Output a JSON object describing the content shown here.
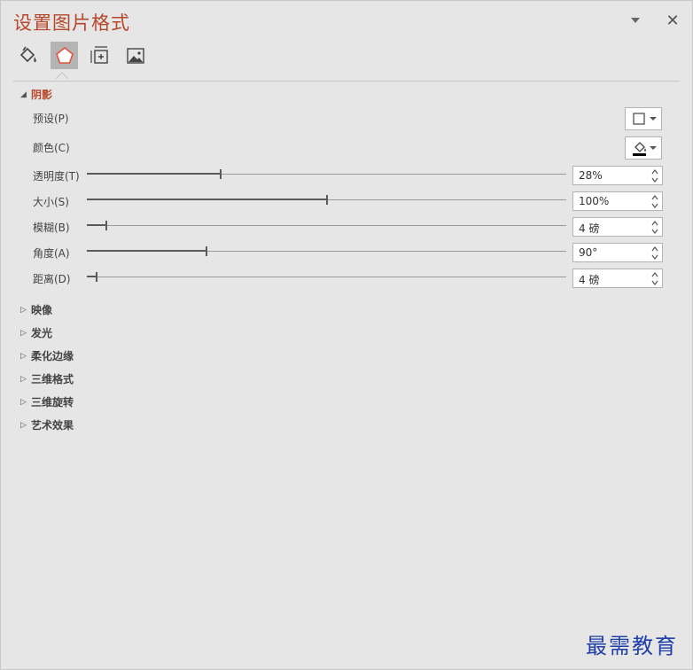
{
  "panel": {
    "title": "设置图片格式",
    "collapse_icon": "chevron-down-icon",
    "close_icon": "close-icon",
    "close_glyph": "✕"
  },
  "tabs": [
    {
      "name": "fill-line",
      "icon": "paint-bucket-icon",
      "active": false
    },
    {
      "name": "effects",
      "icon": "pentagon-icon",
      "active": true
    },
    {
      "name": "size-properties",
      "icon": "size-properties-icon",
      "active": false
    },
    {
      "name": "picture",
      "icon": "picture-icon",
      "active": false
    }
  ],
  "shadow": {
    "header": "阴影",
    "expanded_glyph": "◢",
    "preset_label": "预设(P)",
    "color_label": "颜色(C)",
    "sliders": [
      {
        "label": "透明度(T)",
        "value": "28%",
        "level": 0.28
      },
      {
        "label": "大小(S)",
        "value": "100%",
        "level": 0.5
      },
      {
        "label": "模糊(B)",
        "value": "4 磅",
        "level": 0.04
      },
      {
        "label": "角度(A)",
        "value": "90°",
        "level": 0.25
      },
      {
        "label": "距离(D)",
        "value": "4 磅",
        "level": 0.02
      }
    ]
  },
  "collapsed_glyph": "▷",
  "sections": [
    {
      "label": "映像"
    },
    {
      "label": "发光"
    },
    {
      "label": "柔化边缘"
    },
    {
      "label": "三维格式"
    },
    {
      "label": "三维旋转"
    },
    {
      "label": "艺术效果"
    }
  ],
  "watermark": "最需教育"
}
